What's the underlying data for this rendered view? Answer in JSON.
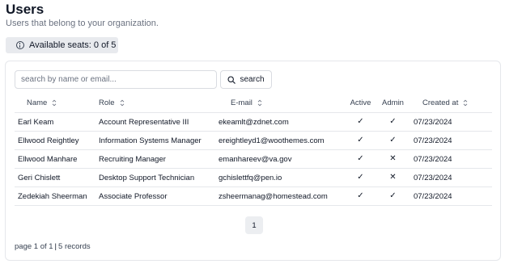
{
  "header": {
    "title": "Users",
    "subtitle": "Users that belong to your organization.",
    "seats_label": "Available seats: 0 of 5"
  },
  "search": {
    "placeholder": "search by name or email...",
    "button_label": "search"
  },
  "table": {
    "columns": [
      "Name",
      "Role",
      "E-mail",
      "Active",
      "Admin",
      "Created at"
    ],
    "rows": [
      {
        "name": "Earl Keam",
        "role": "Account Representative III",
        "email": "ekeamlt@zdnet.com",
        "active": "✓",
        "admin": "✓",
        "created": "07/23/2024"
      },
      {
        "name": "Ellwood Reightley",
        "role": "Information Systems Manager",
        "email": "ereightleyd1@woothemes.com",
        "active": "✓",
        "admin": "✓",
        "created": "07/23/2024"
      },
      {
        "name": "Ellwood Manhare",
        "role": "Recruiting Manager",
        "email": "emanhareev@va.gov",
        "active": "✓",
        "admin": "✕",
        "created": "07/23/2024"
      },
      {
        "name": "Geri Chislett",
        "role": "Desktop Support Technician",
        "email": "gchislettfq@pen.io",
        "active": "✓",
        "admin": "✕",
        "created": "07/23/2024"
      },
      {
        "name": "Zedekiah Sheerman",
        "role": "Associate Professor",
        "email": "zsheermanag@homestead.com",
        "active": "✓",
        "admin": "✓",
        "created": "07/23/2024"
      }
    ]
  },
  "pagination": {
    "current_page": "1",
    "page_text": "page 1 of 1",
    "separator": "|",
    "records_text": "5 records"
  }
}
